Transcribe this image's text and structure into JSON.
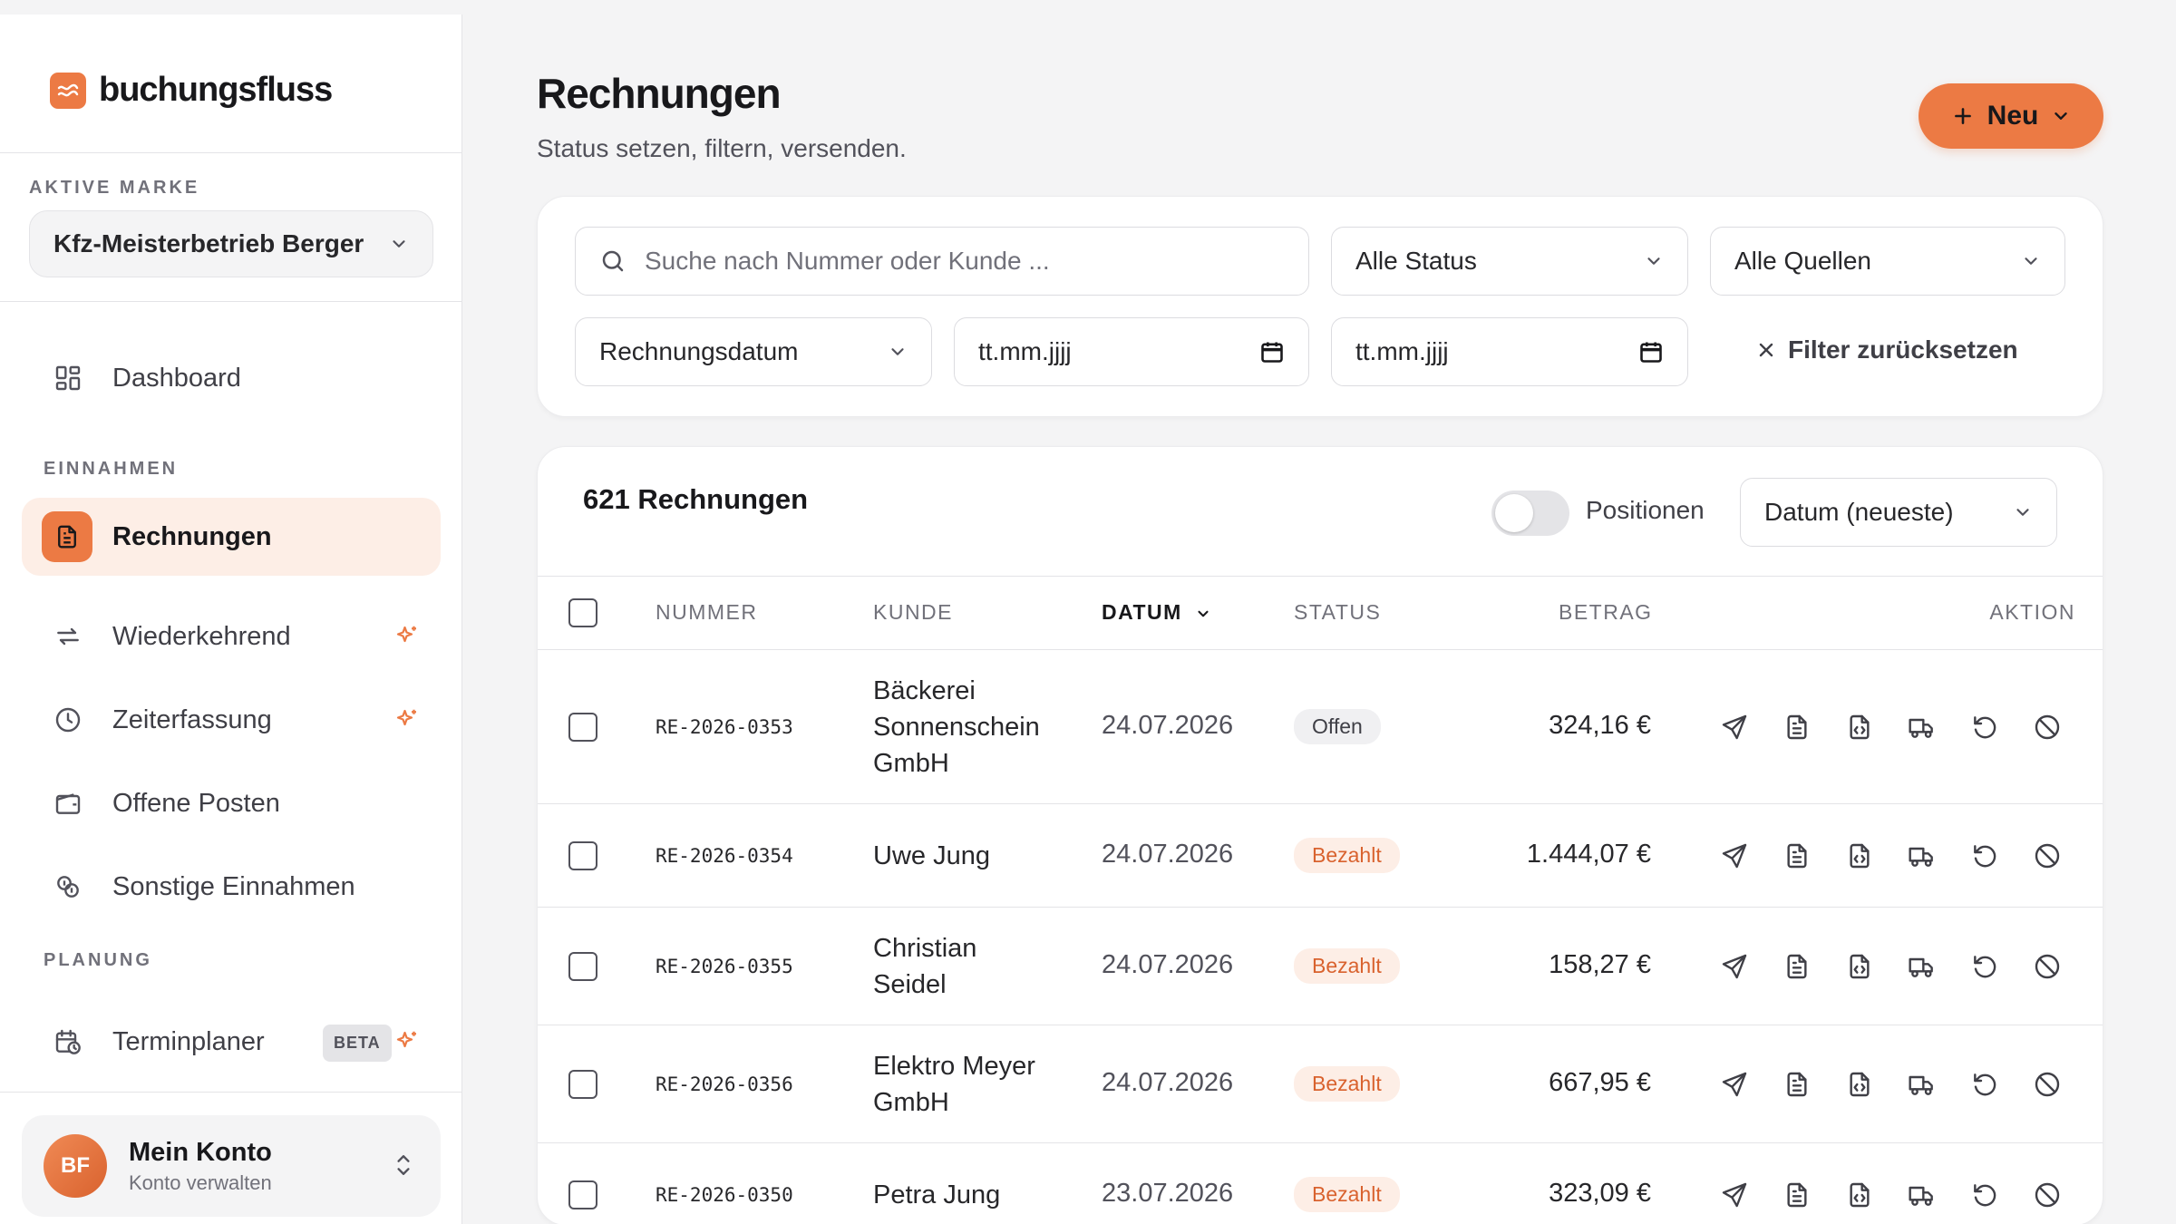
{
  "brand": {
    "name": "buchungsfluss"
  },
  "sidebar": {
    "active_brand_label": "AKTIVE MARKE",
    "active_brand": "Kfz-Meisterbetrieb Berger",
    "dashboard": "Dashboard",
    "section_income": "EINNAHMEN",
    "items_income": [
      {
        "label": "Rechnungen"
      },
      {
        "label": "Wiederkehrend"
      },
      {
        "label": "Zeiterfassung"
      },
      {
        "label": "Offene Posten"
      },
      {
        "label": "Sonstige Einnahmen"
      }
    ],
    "section_planning": "PLANUNG",
    "planner": "Terminplaner",
    "beta": "BETA",
    "account": {
      "initials": "BF",
      "title": "Mein Konto",
      "subtitle": "Konto verwalten"
    }
  },
  "header": {
    "title": "Rechnungen",
    "subtitle": "Status setzen, filtern, versenden.",
    "new_button": "Neu"
  },
  "filters": {
    "search_placeholder": "Suche nach Nummer oder Kunde ...",
    "status": "Alle Status",
    "source": "Alle Quellen",
    "date_type": "Rechnungsdatum",
    "date_from": "tt.mm.jjjj",
    "date_to": "tt.mm.jjjj",
    "reset": "Filter zurücksetzen"
  },
  "table": {
    "count": "621 Rechnungen",
    "toggle_label": "Positionen",
    "sort": "Datum (neueste)",
    "columns": {
      "number": "NUMMER",
      "customer": "KUNDE",
      "date": "DATUM",
      "status": "STATUS",
      "amount": "BETRAG",
      "action": "AKTION"
    },
    "rows": [
      {
        "number": "RE-2026-0353",
        "customer_lines": [
          "Bäckerei",
          "Sonnenschein",
          "GmbH"
        ],
        "date": "24.07.2026",
        "status": "Offen",
        "amount": "324,16 €"
      },
      {
        "number": "RE-2026-0354",
        "customer_lines": [
          "Uwe Jung"
        ],
        "date": "24.07.2026",
        "status": "Bezahlt",
        "amount": "1.444,07 €"
      },
      {
        "number": "RE-2026-0355",
        "customer_lines": [
          "Christian",
          "Seidel"
        ],
        "date": "24.07.2026",
        "status": "Bezahlt",
        "amount": "158,27 €"
      },
      {
        "number": "RE-2026-0356",
        "customer_lines": [
          "Elektro Meyer",
          "GmbH"
        ],
        "date": "24.07.2026",
        "status": "Bezahlt",
        "amount": "667,95 €"
      },
      {
        "number": "RE-2026-0350",
        "customer_lines": [
          "Petra Jung"
        ],
        "date": "23.07.2026",
        "status": "Bezahlt",
        "amount": "323,09 €"
      }
    ]
  },
  "colors": {
    "accent": "#ec7a44",
    "accent_soft": "#fdeee6",
    "background": "#f4f4f5"
  }
}
